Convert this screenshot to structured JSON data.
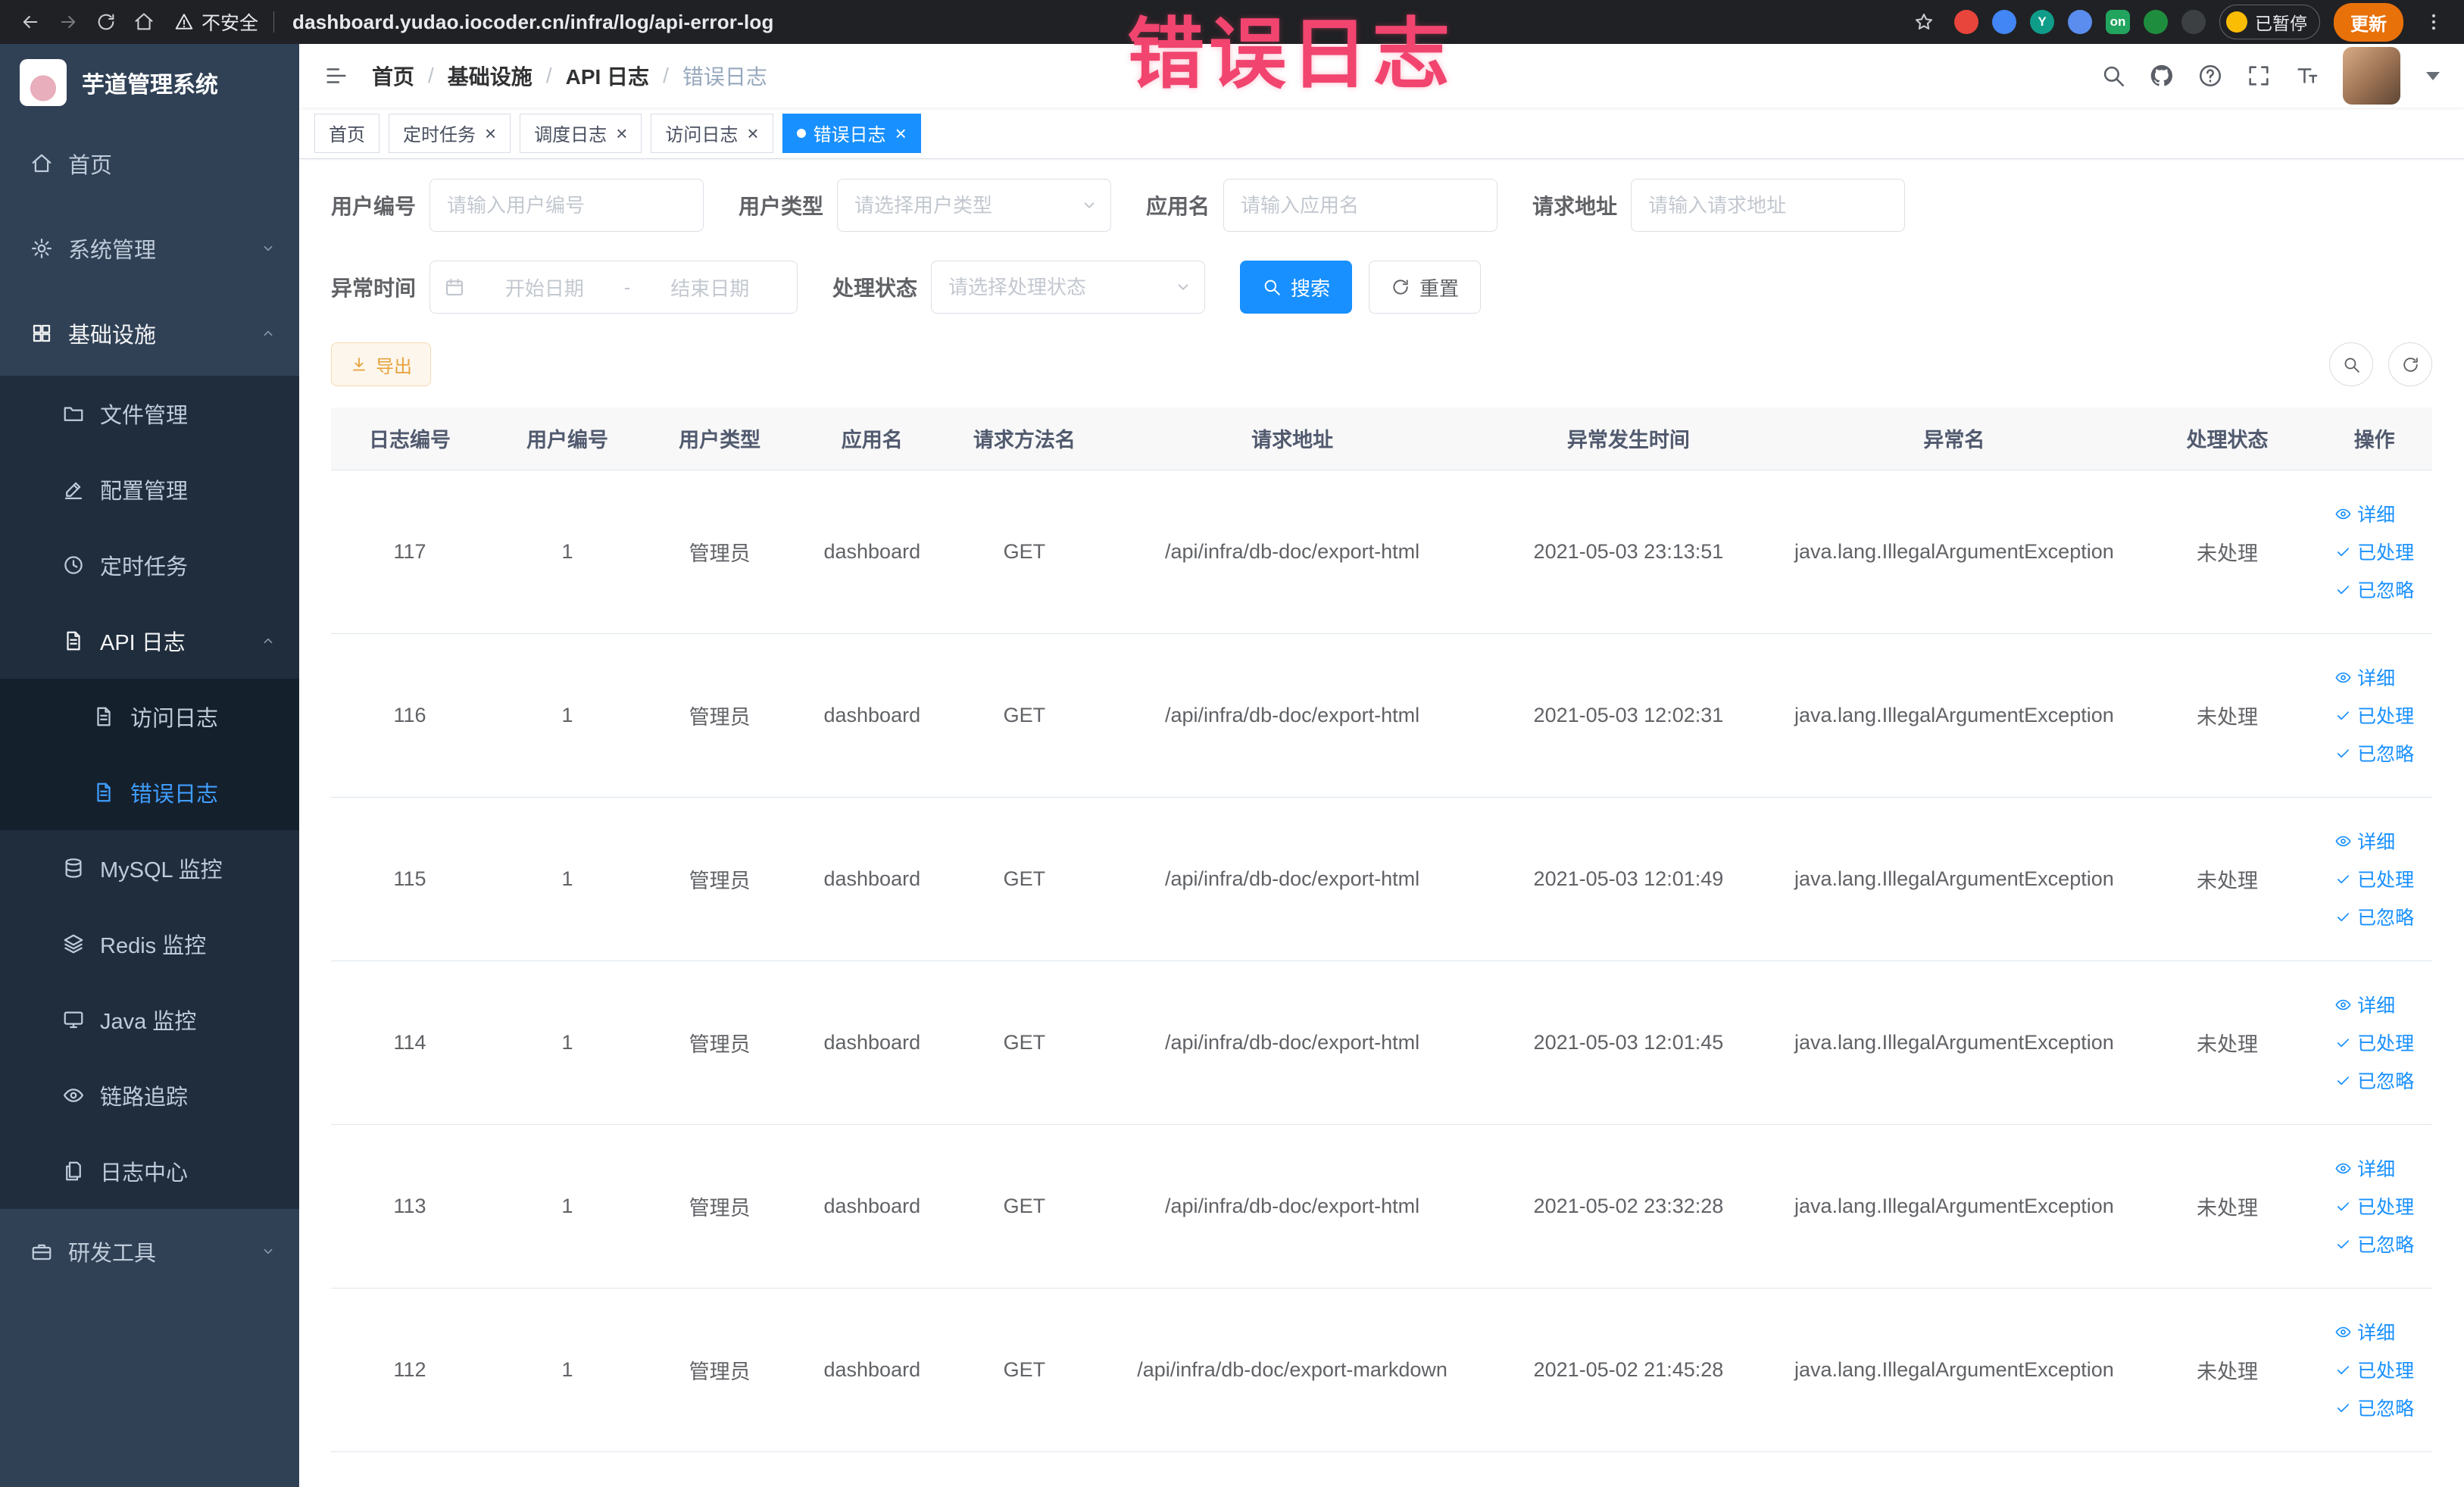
{
  "annotation": {
    "text": "错误日志"
  },
  "browser": {
    "security_label": "不安全",
    "url": "dashboard.yudao.iocoder.cn/infra/log/api-error-log",
    "on_badge": "on",
    "paused_label": "已暂停",
    "update_label": "更新"
  },
  "sidebar": {
    "logo_title": "芋道管理系统",
    "items": [
      {
        "label": "首页"
      },
      {
        "label": "系统管理"
      },
      {
        "label": "基础设施"
      },
      {
        "label": "文件管理"
      },
      {
        "label": "配置管理"
      },
      {
        "label": "定时任务"
      },
      {
        "label": "API 日志"
      },
      {
        "label": "访问日志"
      },
      {
        "label": "错误日志"
      },
      {
        "label": "MySQL 监控"
      },
      {
        "label": "Redis 监控"
      },
      {
        "label": "Java 监控"
      },
      {
        "label": "链路追踪"
      },
      {
        "label": "日志中心"
      },
      {
        "label": "研发工具"
      }
    ]
  },
  "header": {
    "breadcrumb": [
      "首页",
      "基础设施",
      "API 日志",
      "错误日志"
    ],
    "separator": "/"
  },
  "tabs": [
    {
      "label": "首页",
      "closable": false,
      "active": false
    },
    {
      "label": "定时任务",
      "closable": true,
      "active": false
    },
    {
      "label": "调度日志",
      "closable": true,
      "active": false
    },
    {
      "label": "访问日志",
      "closable": true,
      "active": false
    },
    {
      "label": "错误日志",
      "closable": true,
      "active": true
    }
  ],
  "filters": {
    "user_id_label": "用户编号",
    "user_id_placeholder": "请输入用户编号",
    "user_type_label": "用户类型",
    "user_type_placeholder": "请选择用户类型",
    "app_name_label": "应用名",
    "app_name_placeholder": "请输入应用名",
    "request_url_label": "请求地址",
    "request_url_placeholder": "请输入请求地址",
    "exception_time_label": "异常时间",
    "date_start_placeholder": "开始日期",
    "date_separator": "-",
    "date_end_placeholder": "结束日期",
    "status_label": "处理状态",
    "status_placeholder": "请选择处理状态",
    "search_label": "搜索",
    "reset_label": "重置"
  },
  "toolbar": {
    "export_label": "导出"
  },
  "table": {
    "columns": [
      "日志编号",
      "用户编号",
      "用户类型",
      "应用名",
      "请求方法名",
      "请求地址",
      "异常发生时间",
      "异常名",
      "处理状态",
      "操作"
    ],
    "row_actions": [
      "详细",
      "已处理",
      "已忽略"
    ],
    "rows": [
      {
        "id": "117",
        "user_id": "1",
        "user_type": "管理员",
        "app": "dashboard",
        "method": "GET",
        "url": "/api/infra/db-doc/export-html",
        "time": "2021-05-03 23:13:51",
        "exception": "java.lang.IllegalArgumentException",
        "status": "未处理"
      },
      {
        "id": "116",
        "user_id": "1",
        "user_type": "管理员",
        "app": "dashboard",
        "method": "GET",
        "url": "/api/infra/db-doc/export-html",
        "time": "2021-05-03 12:02:31",
        "exception": "java.lang.IllegalArgumentException",
        "status": "未处理"
      },
      {
        "id": "115",
        "user_id": "1",
        "user_type": "管理员",
        "app": "dashboard",
        "method": "GET",
        "url": "/api/infra/db-doc/export-html",
        "time": "2021-05-03 12:01:49",
        "exception": "java.lang.IllegalArgumentException",
        "status": "未处理"
      },
      {
        "id": "114",
        "user_id": "1",
        "user_type": "管理员",
        "app": "dashboard",
        "method": "GET",
        "url": "/api/infra/db-doc/export-html",
        "time": "2021-05-03 12:01:45",
        "exception": "java.lang.IllegalArgumentException",
        "status": "未处理"
      },
      {
        "id": "113",
        "user_id": "1",
        "user_type": "管理员",
        "app": "dashboard",
        "method": "GET",
        "url": "/api/infra/db-doc/export-html",
        "time": "2021-05-02 23:32:28",
        "exception": "java.lang.IllegalArgumentException",
        "status": "未处理"
      },
      {
        "id": "112",
        "user_id": "1",
        "user_type": "管理员",
        "app": "dashboard",
        "method": "GET",
        "url": "/api/infra/db-doc/export-markdown",
        "time": "2021-05-02 21:45:28",
        "exception": "java.lang.IllegalArgumentException",
        "status": "未处理"
      }
    ]
  },
  "colors": {
    "primary": "#1890ff",
    "sidebar_active": "#409eff",
    "warning": "#e6a23c",
    "annotation": "#f1446e",
    "sidebar_bg": "#304156"
  }
}
